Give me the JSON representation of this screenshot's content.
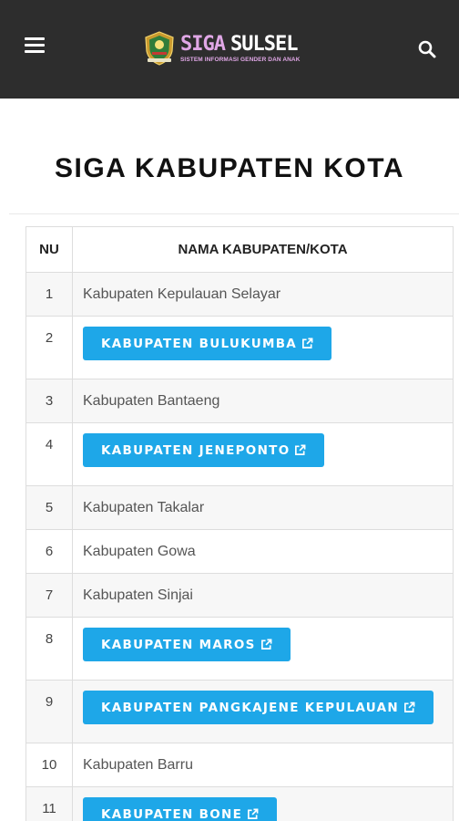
{
  "header": {
    "brand_part1": "SIGA",
    "brand_part2": "SULSEL",
    "brand_subtitle": "SISTEM INFORMASI GENDER DAN ANAK",
    "menu_icon": "hamburger-menu-icon",
    "search_icon": "search-icon",
    "brand_color": "#e0a7e6",
    "bar_color": "#2d2d2d"
  },
  "page": {
    "title": "SIGA KABUPATEN KOTA"
  },
  "table": {
    "headers": {
      "nu": "NU",
      "name": "NAMA KABUPATEN/KOTA"
    },
    "button_color": "#1ea7e8",
    "rows": [
      {
        "nu": "1",
        "name": "Kabupaten Kepulauan Selayar",
        "is_link": false
      },
      {
        "nu": "2",
        "name": "KABUPATEN BULUKUMBA",
        "is_link": true
      },
      {
        "nu": "3",
        "name": "Kabupaten Bantaeng",
        "is_link": false
      },
      {
        "nu": "4",
        "name": "KABUPATEN JENEPONTO",
        "is_link": true
      },
      {
        "nu": "5",
        "name": "Kabupaten Takalar",
        "is_link": false
      },
      {
        "nu": "6",
        "name": "Kabupaten Gowa",
        "is_link": false
      },
      {
        "nu": "7",
        "name": "Kabupaten Sinjai",
        "is_link": false
      },
      {
        "nu": "8",
        "name": "KABUPATEN MAROS",
        "is_link": true
      },
      {
        "nu": "9",
        "name": "KABUPATEN PANGKAJENE KEPULAUAN",
        "is_link": true
      },
      {
        "nu": "10",
        "name": "Kabupaten Barru",
        "is_link": false
      },
      {
        "nu": "11",
        "name": "KABUPATEN BONE",
        "is_link": true
      }
    ]
  }
}
